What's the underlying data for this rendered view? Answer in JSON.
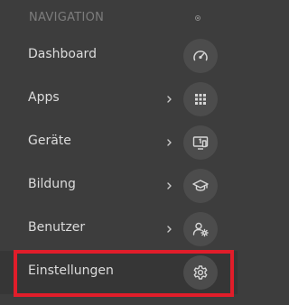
{
  "navigation": {
    "section_title": "NAVIGATION",
    "items": [
      {
        "label": "Dashboard",
        "icon": "speedometer-icon",
        "has_submenu": false
      },
      {
        "label": "Apps",
        "icon": "app-grid-icon",
        "has_submenu": true
      },
      {
        "label": "Geräte",
        "icon": "device-screen-icon",
        "has_submenu": true
      },
      {
        "label": "Bildung",
        "icon": "graduation-cap-icon",
        "has_submenu": true
      },
      {
        "label": "Benutzer",
        "icon": "user-settings-icon",
        "has_submenu": true
      },
      {
        "label": "Einstellungen",
        "icon": "gear-icon",
        "has_submenu": false,
        "active": true
      }
    ]
  },
  "colors": {
    "background": "#3d3d3d",
    "icon_circle": "#4c4c4c",
    "text": "#dcdcdc",
    "header_text": "#7d7d7d",
    "highlight": "#e11d2a"
  }
}
